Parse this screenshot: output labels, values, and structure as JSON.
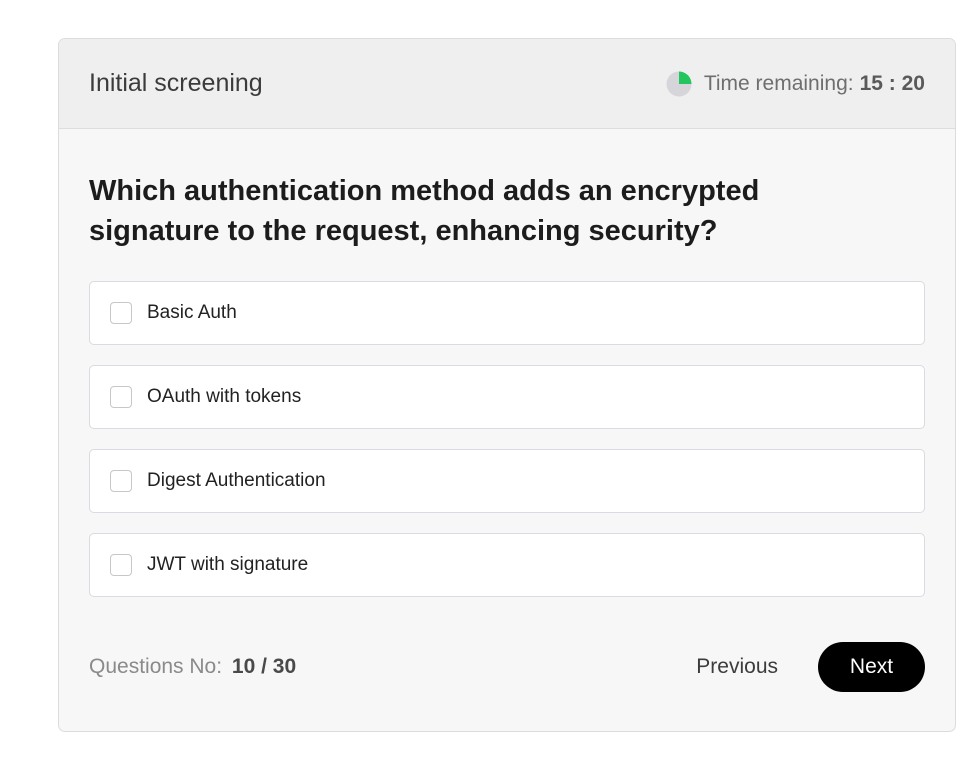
{
  "header": {
    "title": "Initial screening",
    "time_label": "Time remaining:",
    "time_value": "15 : 20",
    "timer_progress_fraction": 0.25,
    "timer_icon": "pie-timer-icon",
    "timer_fill_color": "#22c55e",
    "timer_empty_color": "#d6d6da"
  },
  "question": {
    "text": "Which authentication method adds an encrypted signature to the request, enhancing security?"
  },
  "options": [
    {
      "label": "Basic Auth",
      "checked": false
    },
    {
      "label": "OAuth with tokens",
      "checked": false
    },
    {
      "label": "Digest Authentication",
      "checked": false
    },
    {
      "label": "JWT with signature",
      "checked": false
    }
  ],
  "footer": {
    "progress_label": "Questions No:",
    "progress_value": "10 / 30",
    "previous_label": "Previous",
    "next_label": "Next"
  }
}
